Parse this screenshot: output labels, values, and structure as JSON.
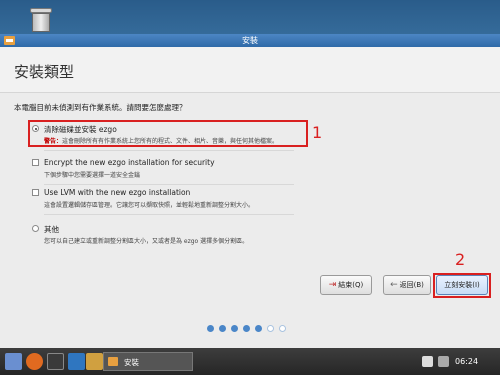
{
  "window": {
    "title": "安裝"
  },
  "page": {
    "heading": "安裝類型",
    "question": "本電腦目前未偵測到有作業系統。請問要怎麼處理？"
  },
  "options": [
    {
      "label": "清除磁碟並安裝 ezgo",
      "desc_prefix": "警告：",
      "desc": "這會刪除所有有作業系統上您所有的程式、文件、相片、音樂，與任何其他檔案。",
      "type": "radio",
      "selected": true
    },
    {
      "label": "Encrypt the new ezgo installation for security",
      "desc": "下個步驟中您需要選擇一道安全金鑰",
      "type": "checkbox",
      "selected": false
    },
    {
      "label": "Use LVM with the new ezgo installation",
      "desc": "這會設置邏輯儲存區管理。它讓您可以擷取快照，並輕鬆地重新調整分割大小。",
      "type": "checkbox",
      "selected": false
    },
    {
      "label": "其他",
      "desc": "您可以自己建立或重新調整分割區大小，又或者是為 ezgo 選擇多個分割區。",
      "type": "radio",
      "selected": false
    }
  ],
  "buttons": {
    "quit": "結束(Q)",
    "back": "返回(B)",
    "install": "立刻安裝(I)"
  },
  "annotations": {
    "one": "1",
    "two": "2"
  },
  "progress": {
    "current_step": 5,
    "total_steps": 7
  },
  "taskbar": {
    "task_label": "安裝",
    "clock": "06:24"
  },
  "colors": {
    "accent": "#4a86c8",
    "highlight": "#d92020",
    "warning": "#c00000"
  }
}
